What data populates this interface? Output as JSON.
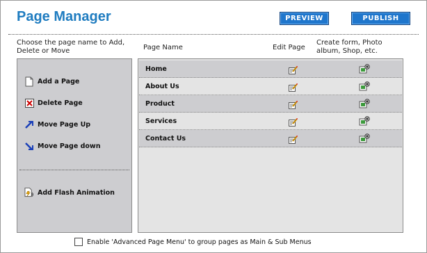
{
  "title": "Page Manager",
  "buttons": {
    "preview": "PREVIEW",
    "publish": "PUBLISH"
  },
  "headers": {
    "left": "Choose the page name to Add, Delete or Move",
    "page_name": "Page Name",
    "edit_page": "Edit Page",
    "create": "Create form, Photo album, Shop, etc."
  },
  "actions": [
    {
      "label": "Add a Page",
      "icon": "page-icon"
    },
    {
      "label": "Delete Page",
      "icon": "delete-icon"
    },
    {
      "label": "Move Page Up",
      "icon": "move-up-icon"
    },
    {
      "label": "Move Page down",
      "icon": "move-down-icon"
    },
    {
      "label": "Add Flash Animation",
      "icon": "flash-icon"
    }
  ],
  "pages": [
    {
      "name": "Home"
    },
    {
      "name": "About Us"
    },
    {
      "name": "Product"
    },
    {
      "name": "Services"
    },
    {
      "name": "Contact Us"
    }
  ],
  "footer": {
    "checkbox_label": "Enable 'Advanced Page Menu' to group pages as Main & Sub Menus",
    "checked": false
  }
}
